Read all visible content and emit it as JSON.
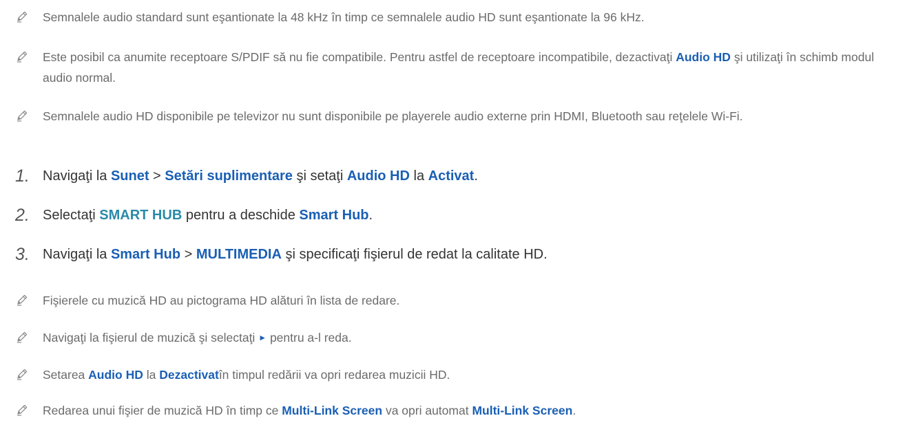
{
  "colors": {
    "highlight": "#1a5fb4",
    "highlight_alt": "#2a8aa8",
    "note_text": "#6b6b6b",
    "step_text": "#333333"
  },
  "icons": {
    "note": "pencil-icon",
    "play": "play-icon"
  },
  "notes_top": [
    {
      "segments": [
        "Semnalele audio standard sunt eşantionate la 48 kHz în timp ce semnalele audio HD sunt eşantionate la 96 kHz."
      ]
    },
    {
      "segments": [
        "Este posibil ca anumite receptoare S/PDIF să nu fie compatibile. Pentru astfel de receptoare incompatibile, dezactivaţi ",
        "Audio HD",
        " şi utilizaţi în schimb modul audio normal."
      ]
    },
    {
      "segments": [
        "Semnalele audio HD disponibile pe televizor nu sunt disponibile pe playerele audio externe prin HDMI, Bluetooth sau reţelele Wi-Fi."
      ]
    }
  ],
  "steps": [
    {
      "number": "1.",
      "segments": [
        "Navigaţi la ",
        "Sunet",
        " > ",
        "Setări suplimentare",
        " şi setaţi ",
        "Audio HD",
        " la ",
        "Activat",
        "."
      ]
    },
    {
      "number": "2.",
      "segments": [
        "Selectaţi ",
        "SMART HUB",
        " pentru a deschide ",
        "Smart Hub",
        "."
      ]
    },
    {
      "number": "3.",
      "segments": [
        "Navigaţi la ",
        "Smart Hub",
        " > ",
        "MULTIMEDIA",
        " şi specificaţi fişierul de redat la calitate HD."
      ]
    }
  ],
  "notes_bottom": [
    {
      "segments": [
        "Fişierele cu muzică HD au pictograma HD alături în lista de redare."
      ]
    },
    {
      "segments": [
        "Navigaţi la fişierul de muzică şi selectaţi ",
        "►",
        " pentru a-l reda."
      ]
    },
    {
      "segments": [
        "Setarea ",
        "Audio HD",
        " la ",
        "Dezactivat",
        "în timpul redării va opri redarea muzicii HD."
      ]
    },
    {
      "segments": [
        "Redarea unui fişier de muzică HD în timp ce ",
        "Multi-Link Screen",
        " va opri automat ",
        "Multi-Link Screen",
        "."
      ]
    }
  ]
}
